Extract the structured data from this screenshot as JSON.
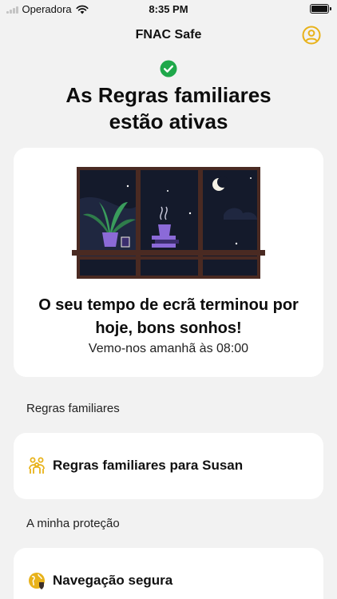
{
  "status_bar": {
    "carrier": "Operadora",
    "time": "8:35 PM"
  },
  "nav": {
    "title": "FNAC Safe",
    "profile_icon": "profile-icon"
  },
  "headline": {
    "line1": "As Regras familiares",
    "line2": "estão ativas"
  },
  "bedtime_card": {
    "title_line1": "O seu tempo de ecrã terminou por",
    "title_line2": "hoje, bons sonhos!",
    "subtitle": "Vemo-nos amanhã às 08:00"
  },
  "sections": {
    "family_rules": {
      "label": "Regras familiares",
      "items": [
        {
          "label": "Regras familiares para Susan",
          "icon": "family-icon"
        }
      ]
    },
    "protection": {
      "label": "A minha proteção",
      "items": [
        {
          "label": "Navegação segura",
          "icon": "globe-shield-icon"
        }
      ]
    }
  },
  "colors": {
    "accent": "#e8b21a",
    "success": "#1fa84a",
    "background": "#f2f2f2",
    "night_sky": "#141a2b",
    "window_frame": "#4a2a22",
    "plant_pot": "#8b6ad8"
  }
}
